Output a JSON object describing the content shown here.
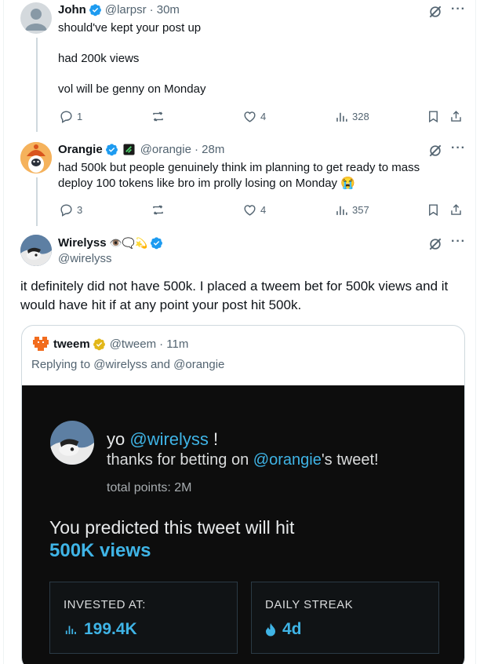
{
  "reply1": {
    "name": "John",
    "handle": "@larpsr",
    "time": "· 30m",
    "lines": [
      "should've kept your post up",
      "had 200k views",
      "vol will be genny on Monday"
    ],
    "replies": "1",
    "reposts": "",
    "likes": "4",
    "views": "328"
  },
  "reply2": {
    "name": "Orangie",
    "handle": "@orangie",
    "time": "· 28m",
    "text_line1": "had 500k but people genuinely think im planning to get ready to mass",
    "text_line2": "deploy 100 tokens like bro im prolly losing on Monday",
    "emoji": "😭",
    "replies": "3",
    "reposts": "",
    "likes": "4",
    "views": "357"
  },
  "main": {
    "name": "Wirelyss",
    "name_emojis": "👁️🗨️💫",
    "handle": "@wirelyss",
    "text": "it definitely did not have 500k. I placed a tweem bet for 500k views and it would have hit if at any point your post hit 500k."
  },
  "quote": {
    "name": "tweem",
    "handle": "@tweem",
    "time": "· 11m",
    "replying": "Replying to @wirelyss and @orangie",
    "card": {
      "yo": "yo ",
      "yo_handle": "@wirelyss",
      "yo_end": " !",
      "thanks_start": "thanks for betting on ",
      "thanks_handle": "@orangie",
      "thanks_end": "'s tweet!",
      "points": "total points: 2M",
      "predicted": "You predicted this tweet will hit",
      "target": "500K views",
      "invested_label": "INVESTED AT:",
      "invested_value": "199.4K",
      "streak_label": "DAILY STREAK",
      "streak_value": "4d"
    }
  },
  "colors": {
    "verified": "#1d9bf0",
    "gold_verified": "#e2b719",
    "accent": "#3fb4e6"
  },
  "icons": [
    "reply-icon",
    "repost-icon",
    "like-icon",
    "views-icon",
    "bookmark-icon",
    "share-icon",
    "grok-icon",
    "more-icon"
  ]
}
